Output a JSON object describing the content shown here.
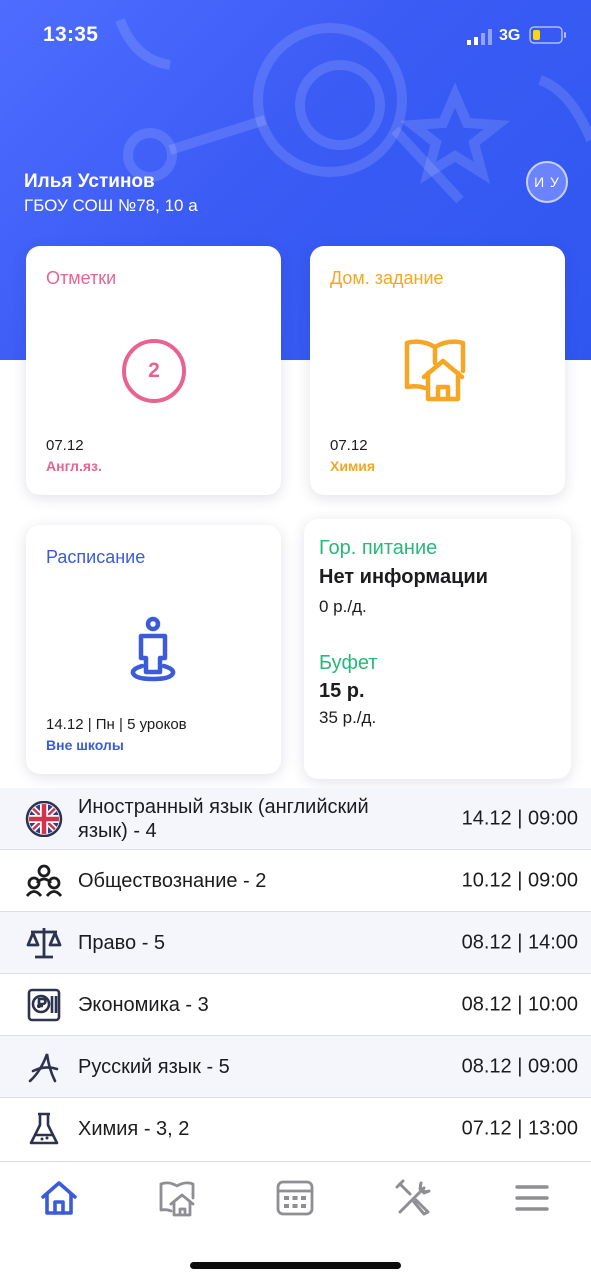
{
  "status_bar": {
    "time": "13:35",
    "network": "3G"
  },
  "user": {
    "name": "Илья Устинов",
    "school": "ГБОУ СОШ №78, 10 а",
    "initials": "И У"
  },
  "cards": {
    "marks": {
      "title": "Отметки",
      "grade": "2",
      "date": "07.12",
      "subject": "Англ.яз."
    },
    "homework": {
      "title": "Дом. задание",
      "date": "07.12",
      "subject": "Химия"
    },
    "schedule": {
      "title": "Расписание",
      "info": "14.12 | Пн | 5 уроков",
      "status": "Вне школы"
    },
    "food": {
      "city_title": "Гор. питание",
      "city_value": "Нет информации",
      "city_rate": "0 р./д.",
      "buffet_title": "Буфет",
      "buffet_value": "15 р.",
      "buffet_rate": "35 р./д."
    }
  },
  "marks_list": [
    {
      "icon": "uk-flag-icon",
      "subject": "Иностранный язык (английский язык) - 4",
      "date": "14.12 | 09:00"
    },
    {
      "icon": "people-icon",
      "subject": "Обществознание - 2",
      "date": "10.12 | 09:00"
    },
    {
      "icon": "scales-icon",
      "subject": "Право - 5",
      "date": "08.12 | 14:00"
    },
    {
      "icon": "money-icon",
      "subject": "Экономика - 3",
      "date": "08.12 | 10:00"
    },
    {
      "icon": "letter-a-icon",
      "subject": "Русский язык - 5",
      "date": "08.12 | 09:00"
    },
    {
      "icon": "flask-icon",
      "subject": "Химия - 3, 2",
      "date": "07.12 | 13:00"
    }
  ],
  "tabbar": [
    "home-icon",
    "homework-icon",
    "calendar-icon",
    "tools-icon",
    "menu-icon"
  ],
  "colors": {
    "header": "#3b5bf5",
    "marks": "#e8648f",
    "homework": "#f5a623",
    "schedule": "#3b5bdb",
    "food": "#27b87a",
    "tab_active": "#3b5bdb",
    "tab_inactive": "#8e8e93"
  }
}
